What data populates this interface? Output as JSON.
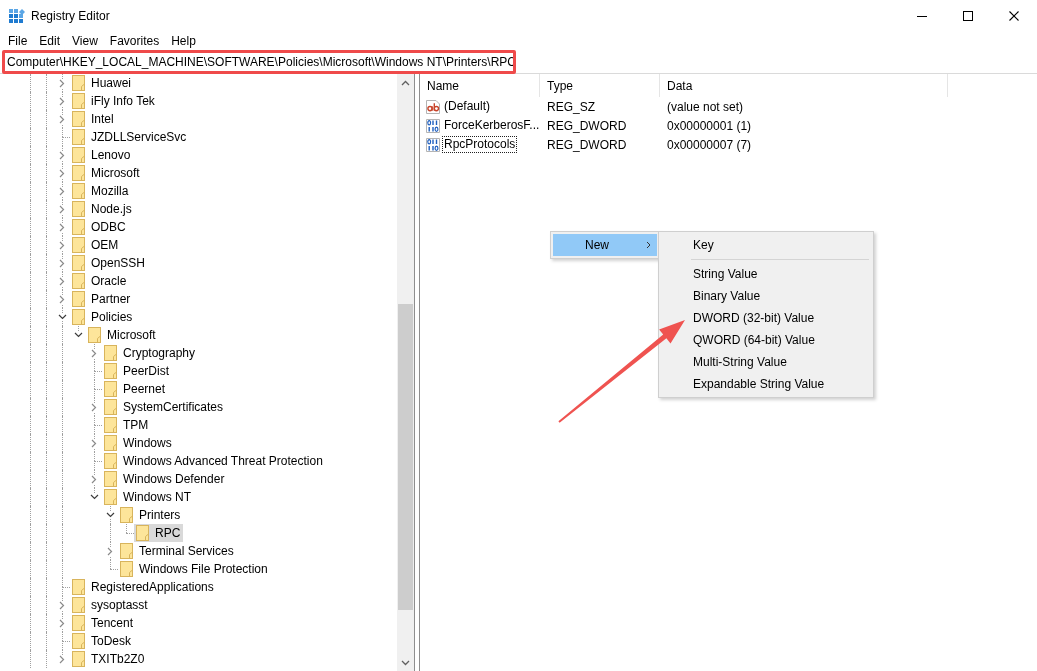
{
  "window": {
    "title": "Registry Editor"
  },
  "menu_bar": [
    {
      "label": "File"
    },
    {
      "label": "Edit"
    },
    {
      "label": "View"
    },
    {
      "label": "Favorites"
    },
    {
      "label": "Help"
    }
  ],
  "address_bar": {
    "value": "Computer\\HKEY_LOCAL_MACHINE\\SOFTWARE\\Policies\\Microsoft\\Windows NT\\Printers\\RPC",
    "highlighted": true
  },
  "tree": [
    {
      "name": "Huawei",
      "expandable": true,
      "expanded": false,
      "selected": false
    },
    {
      "name": "iFly Info Tek",
      "expandable": true,
      "expanded": false,
      "selected": false
    },
    {
      "name": "Intel",
      "expandable": true,
      "expanded": false,
      "selected": false
    },
    {
      "name": "JZDLLServiceSvc",
      "expandable": false,
      "selected": false
    },
    {
      "name": "Lenovo",
      "expandable": true,
      "expanded": false,
      "selected": false
    },
    {
      "name": "Microsoft",
      "expandable": true,
      "expanded": false,
      "selected": false
    },
    {
      "name": "Mozilla",
      "expandable": true,
      "expanded": false,
      "selected": false
    },
    {
      "name": "Node.js",
      "expandable": true,
      "expanded": false,
      "selected": false
    },
    {
      "name": "ODBC",
      "expandable": true,
      "expanded": false,
      "selected": false
    },
    {
      "name": "OEM",
      "expandable": true,
      "expanded": false,
      "selected": false
    },
    {
      "name": "OpenSSH",
      "expandable": true,
      "expanded": false,
      "selected": false
    },
    {
      "name": "Oracle",
      "expandable": true,
      "expanded": false,
      "selected": false
    },
    {
      "name": "Partner",
      "expandable": true,
      "expanded": false,
      "selected": false
    },
    {
      "name": "Policies",
      "expandable": true,
      "expanded": true,
      "selected": false,
      "children": [
        {
          "name": "Microsoft",
          "expandable": true,
          "expanded": true,
          "selected": false,
          "children": [
            {
              "name": "Cryptography",
              "expandable": true,
              "expanded": false,
              "selected": false
            },
            {
              "name": "PeerDist",
              "expandable": false,
              "selected": false
            },
            {
              "name": "Peernet",
              "expandable": false,
              "selected": false
            },
            {
              "name": "SystemCertificates",
              "expandable": true,
              "expanded": false,
              "selected": false
            },
            {
              "name": "TPM",
              "expandable": false,
              "selected": false
            },
            {
              "name": "Windows",
              "expandable": true,
              "expanded": false,
              "selected": false
            },
            {
              "name": "Windows Advanced Threat Protection",
              "expandable": false,
              "selected": false
            },
            {
              "name": "Windows Defender",
              "expandable": true,
              "expanded": false,
              "selected": false
            },
            {
              "name": "Windows NT",
              "expandable": true,
              "expanded": true,
              "selected": false,
              "children": [
                {
                  "name": "Printers",
                  "expandable": true,
                  "expanded": true,
                  "selected": false,
                  "children": [
                    {
                      "name": "RPC",
                      "expandable": false,
                      "selected": true
                    }
                  ]
                },
                {
                  "name": "Terminal Services",
                  "expandable": true,
                  "expanded": false,
                  "selected": false
                },
                {
                  "name": "Windows File Protection",
                  "expandable": false,
                  "selected": false
                }
              ]
            }
          ]
        }
      ]
    },
    {
      "name": "RegisteredApplications",
      "expandable": false,
      "selected": false
    },
    {
      "name": "sysoptasst",
      "expandable": true,
      "expanded": false,
      "selected": false
    },
    {
      "name": "Tencent",
      "expandable": true,
      "expanded": false,
      "selected": false
    },
    {
      "name": "ToDesk",
      "expandable": false,
      "selected": false
    },
    {
      "name": "TXITb2Z0",
      "expandable": true,
      "expanded": false,
      "selected": false
    }
  ],
  "values_list": {
    "columns": [
      "Name",
      "Type",
      "Data"
    ],
    "rows": [
      {
        "name": "(Default)",
        "type": "REG_SZ",
        "data": "(value not set)",
        "kind": "string",
        "focused": false
      },
      {
        "name": "ForceKerberosF...",
        "type": "REG_DWORD",
        "data": "0x00000001 (1)",
        "kind": "dword",
        "focused": false
      },
      {
        "name": "RpcProtocols",
        "type": "REG_DWORD",
        "data": "0x00000007 (7)",
        "kind": "dword",
        "focused": true
      }
    ]
  },
  "context_menu": {
    "items": [
      {
        "label": "New",
        "selected": true,
        "has_submenu": true
      }
    ],
    "submenu": {
      "arrow_annotation": true,
      "items": [
        {
          "kind": "item",
          "label": "Key",
          "selected": false
        },
        {
          "kind": "separator"
        },
        {
          "kind": "item",
          "label": "String Value",
          "selected": false
        },
        {
          "kind": "item",
          "label": "Binary Value",
          "selected": false
        },
        {
          "kind": "item",
          "label": "DWORD (32-bit) Value",
          "selected": false
        },
        {
          "kind": "item",
          "label": "QWORD (64-bit) Value",
          "selected": false
        },
        {
          "kind": "item",
          "label": "Multi-String Value",
          "selected": false
        },
        {
          "kind": "item",
          "label": "Expandable String Value",
          "selected": false
        }
      ]
    }
  }
}
